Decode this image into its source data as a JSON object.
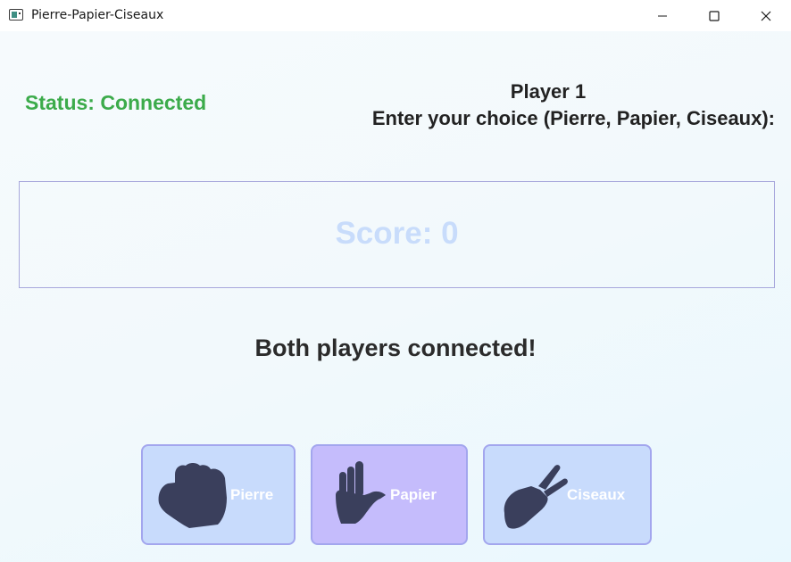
{
  "window": {
    "title": "Pierre-Papier-Ciseaux",
    "icon": "app-window-icon",
    "controls": [
      "minimize-icon",
      "maximize-icon",
      "close-icon"
    ]
  },
  "status": {
    "text": "Status: Connected",
    "color": "#3cab4b"
  },
  "player": {
    "label": "Player 1",
    "prompt": "Enter your choice (Pierre, Papier, Ciseaux):"
  },
  "score": {
    "text": "Score: 0",
    "color": "#c8dcfb"
  },
  "message": "Both players connected!",
  "choices": [
    {
      "label": "Pierre",
      "icon": "fist-icon",
      "selected": false
    },
    {
      "label": "Papier",
      "icon": "open-hand-icon",
      "selected": true
    },
    {
      "label": "Ciseaux",
      "icon": "scissors-hand-icon",
      "selected": false
    }
  ],
  "colors": {
    "button_bg": "#c8dbfc",
    "button_selected_bg": "#c5bcfc",
    "button_border": "#a3a6ee",
    "icon": "#3a3f5c"
  }
}
